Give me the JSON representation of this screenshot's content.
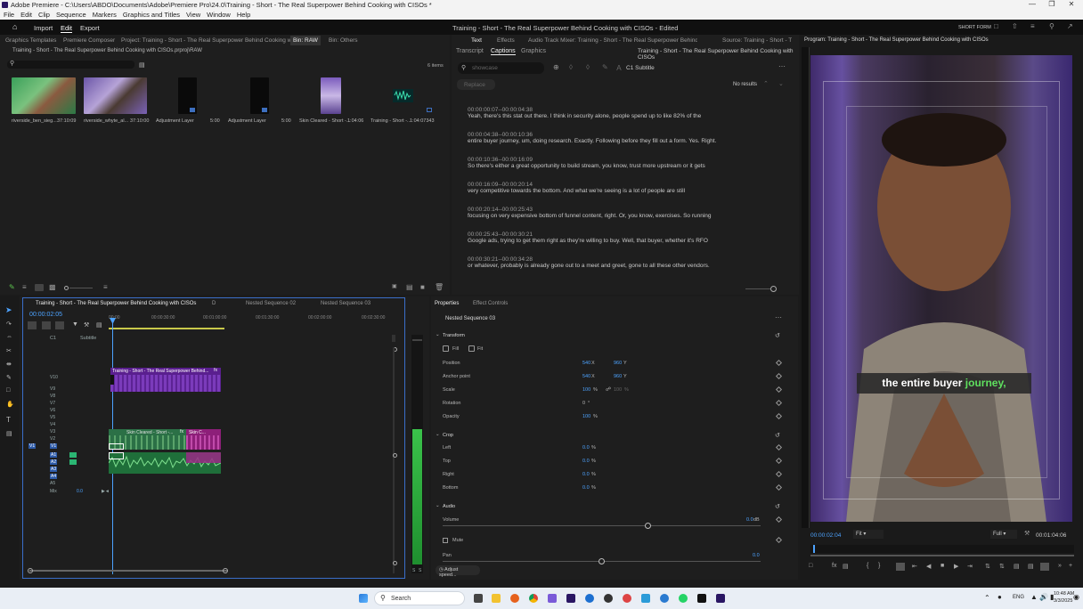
{
  "window": {
    "title": "Adobe Premiere - C:\\Users\\ABDO\\Documents\\Adobe\\Premiere Pro\\24.0\\Training - Short - The Real Superpower Behind Cooking with CISOs *"
  },
  "menu": [
    "File",
    "Edit",
    "Clip",
    "Sequence",
    "Markers",
    "Graphics and Titles",
    "View",
    "Window",
    "Help"
  ],
  "appbar": {
    "tabs": [
      "Import",
      "Edit",
      "Export"
    ],
    "active": "Edit",
    "center_title": "Training - Short - The Real Superpower Behind Cooking with CISOs - Edited",
    "mode": "SHORT FORM"
  },
  "project": {
    "tabs": [
      "Graphics Templates",
      "Premiere Composer",
      "Project: Training - Short - The Real Superpower Behind Cooking with CISOs",
      "Bin: RAW",
      "Bin: Others"
    ],
    "path": "Training - Short - The Real Superpower Behind Cooking with CISOs.prproj\\RAW",
    "item_count": "6 items",
    "items": [
      {
        "name": "riverside_ben_sieg...",
        "dur": "37:10:09"
      },
      {
        "name": "riverside_whyte_al...",
        "dur": "37:10:00"
      },
      {
        "name": "Adjustment Layer",
        "dur": "5:00"
      },
      {
        "name": "Adjustment Layer",
        "dur": "5:00"
      },
      {
        "name": "Skin Cleared - Short -...",
        "dur": "1:04:06"
      },
      {
        "name": "Training - Short -...",
        "dur": "1:04:07343"
      }
    ]
  },
  "text_panel": {
    "tabs": [
      "Text",
      "Effects",
      "Audio Track Mixer: Training - Short - The Real Superpower Behind Cooking with CISOs",
      "Source: Training - Short - The Re"
    ],
    "subtabs": [
      "Transcript",
      "Captions",
      "Graphics"
    ],
    "active_subtab": "Captions",
    "sequence_title": "Training - Short - The Real Superpower Behind Cooking with CISOs",
    "search_placeholder": "showcase",
    "track": "C1 Subtitle",
    "replace_label": "Replace",
    "no_results": "No results",
    "captions": [
      {
        "tc": "00:00:00:07--00:00:04:38",
        "text": "Yeah, there's this stat out there. I think in security alone, people spend up to like 82% of the"
      },
      {
        "tc": "00:00:04:38--00:00:10:36",
        "text": "entire buyer journey, um, doing research. Exactly. Following before they fill out a form. Yes. Right."
      },
      {
        "tc": "00:00:10:36--00:00:16:09",
        "text": "So there's either a great opportunity to build stream, you know, trust more upstream or it gets"
      },
      {
        "tc": "00:00:16:09--00:00:20:14",
        "text": "very competitive towards the bottom. And what we're seeing is a lot of people are still"
      },
      {
        "tc": "00:00:20:14--00:00:25:43",
        "text": "focusing on very expensive bottom of funnel content, right. Or, you know, exercises. So running"
      },
      {
        "tc": "00:00:25:43--00:00:30:21",
        "text": "Google ads, trying to get them right as they're willing to buy. Well, that buyer, whether it's RFO"
      },
      {
        "tc": "00:00:30:21--00:00:34:28",
        "text": "or whatever, probably is already gone out to a meet and greet, gone to all these other vendors."
      }
    ]
  },
  "program": {
    "tab": "Program: Training - Short - The Real Superpower Behind Cooking with CISOs",
    "caption_white": "the entire buyer ",
    "caption_green": "journey,",
    "timecode": "00:00:02:04",
    "fit": "Fit",
    "quality": "Full",
    "duration": "00:01:04:06"
  },
  "timeline": {
    "tabs": [
      "Training - Short - The Real Superpower Behind Cooking with CISOs",
      "D",
      "Nested Sequence 02",
      "Nested Sequence 03"
    ],
    "timecode": "00:00:02:05",
    "ruler": [
      "00:00",
      "00:00:30:00",
      "00:01:00:00",
      "00:01:30:00",
      "00:02:00:00",
      "00:02:30:00"
    ],
    "subtitle_track": "Subtitle",
    "clip_v10": "Training - Short - The Real Superpower Behind...",
    "clip_v3a": "Skin Cleared - Short -...",
    "clip_v3b": "Skin C...",
    "video_tracks": [
      "V10",
      "V9",
      "V8",
      "V7",
      "V6",
      "V5",
      "V4",
      "V3",
      "V2",
      "V1"
    ],
    "audio_tracks": [
      "A1",
      "A2",
      "A3",
      "A4",
      "A5"
    ],
    "mix_label": "Mix",
    "mix_value": "0.0",
    "meter_labels": [
      "S",
      "S"
    ]
  },
  "properties": {
    "tabs": [
      "Properties",
      "Effect Controls"
    ],
    "target": "Nested Sequence 03",
    "sections": {
      "transform": "Transform",
      "crop": "Crop",
      "audio": "Audio"
    },
    "fill": "Fill",
    "fit": "Fit",
    "position": {
      "label": "Position",
      "x": "540",
      "y": "960"
    },
    "anchor": {
      "label": "Anchor point",
      "x": "540",
      "y": "960"
    },
    "scale": {
      "label": "Scale",
      "w": "100",
      "h": "100"
    },
    "rotation": {
      "label": "Rotation",
      "v": "0"
    },
    "opacity": {
      "label": "Opacity",
      "v": "100"
    },
    "crop_left": {
      "label": "Left",
      "v": "0.0"
    },
    "crop_top": {
      "label": "Top",
      "v": "0.0"
    },
    "crop_right": {
      "label": "Right",
      "v": "0.0"
    },
    "crop_bottom": {
      "label": "Bottom",
      "v": "0.0"
    },
    "volume": {
      "label": "Volume",
      "v": "0.0"
    },
    "mute": "Mute",
    "pan": {
      "label": "Pan",
      "v": "0.0"
    },
    "adjust_speed": "Adjust speed..."
  },
  "taskbar": {
    "search": "Search",
    "lang": "ENG",
    "time": "10:48 AM",
    "date": "3/3/2025"
  }
}
